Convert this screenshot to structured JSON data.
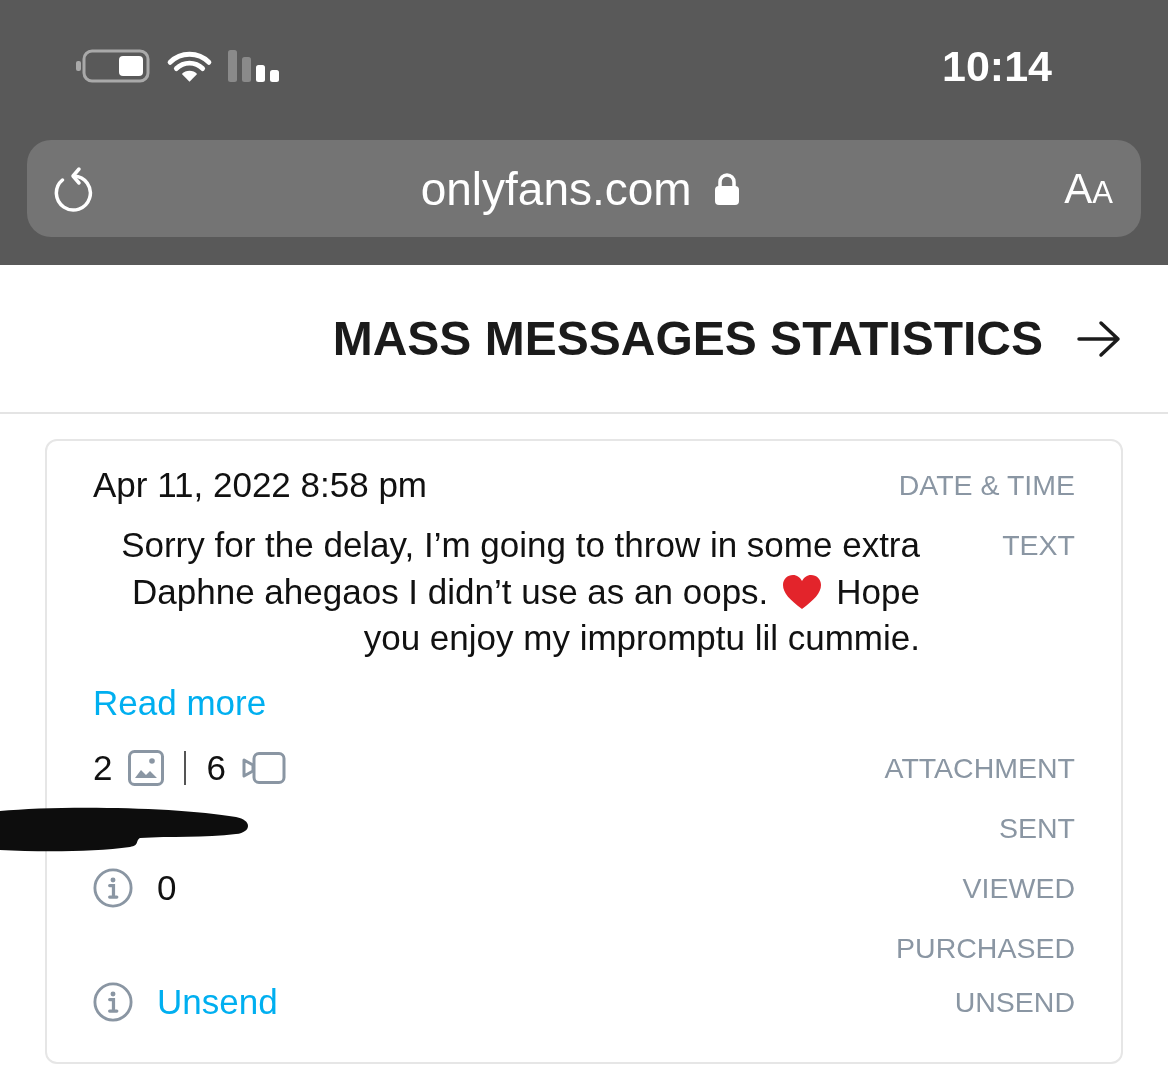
{
  "status_bar": {
    "time": "10:14"
  },
  "address_bar": {
    "text_size_button": "AA",
    "url": "onlyfans.com",
    "secure": true
  },
  "header": {
    "title": "MASS MESSAGES STATISTICS"
  },
  "stats": [
    {
      "kind": "date",
      "label": "DATE & TIME",
      "value": "Apr 11, 2022 8:58 pm"
    },
    {
      "kind": "message",
      "label": "TEXT",
      "lines": [
        {
          "parts": [
            {
              "kind": "text",
              "text": "Sorry for the delay, I’m going to throw in some extra"
            }
          ]
        },
        {
          "parts": [
            {
              "kind": "text",
              "text": "Daphne ahegaos I didn’t use as an oops."
            },
            {
              "kind": "emoji"
            },
            {
              "kind": "text",
              "text": "Hope"
            }
          ]
        },
        {
          "parts": [
            {
              "kind": "text",
              "text": "you enjoy my impromptu lil cummie."
            }
          ]
        }
      ],
      "link": "Read more"
    },
    {
      "kind": "attachment",
      "label": "ATTACHMENT",
      "items": [
        {
          "kind": "photo",
          "count": "2"
        },
        {
          "kind": "video",
          "count": "6"
        }
      ]
    },
    {
      "kind": "redacted",
      "label": "SENT"
    },
    {
      "kind": "count",
      "label": "VIEWED",
      "value": "0"
    },
    {
      "kind": "none",
      "label": "PURCHASED"
    },
    {
      "kind": "unsend",
      "label": "UNSEND",
      "link": "Unsend"
    }
  ]
}
